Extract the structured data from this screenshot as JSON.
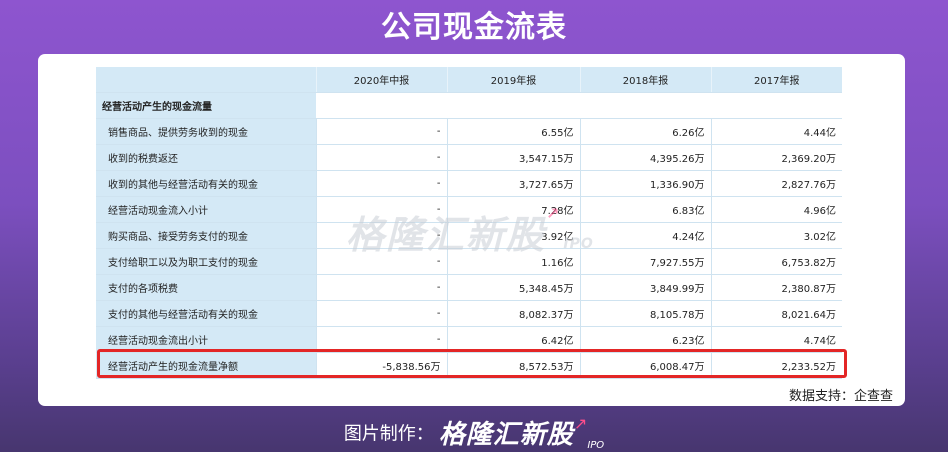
{
  "title": "公司现金流表",
  "table": {
    "headers": [
      "",
      "2020年中报",
      "2019年报",
      "2018年报",
      "2017年报"
    ],
    "section": "经营活动产生的现金流量",
    "rows": [
      {
        "label": "销售商品、提供劳务收到的现金",
        "values": [
          "-",
          "6.55亿",
          "6.26亿",
          "4.44亿"
        ]
      },
      {
        "label": "收到的税费返还",
        "values": [
          "-",
          "3,547.15万",
          "4,395.26万",
          "2,369.20万"
        ]
      },
      {
        "label": "收到的其他与经营活动有关的现金",
        "values": [
          "-",
          "3,727.65万",
          "1,336.90万",
          "2,827.76万"
        ]
      },
      {
        "label": "经营活动现金流入小计",
        "values": [
          "-",
          "7.28亿",
          "6.83亿",
          "4.96亿"
        ]
      },
      {
        "label": "购买商品、接受劳务支付的现金",
        "values": [
          "-",
          "3.92亿",
          "4.24亿",
          "3.02亿"
        ]
      },
      {
        "label": "支付给职工以及为职工支付的现金",
        "values": [
          "-",
          "1.16亿",
          "7,927.55万",
          "6,753.82万"
        ]
      },
      {
        "label": "支付的各项税费",
        "values": [
          "-",
          "5,348.45万",
          "3,849.99万",
          "2,380.87万"
        ]
      },
      {
        "label": "支付的其他与经营活动有关的现金",
        "values": [
          "-",
          "8,082.37万",
          "8,105.78万",
          "8,021.64万"
        ]
      },
      {
        "label": "经营活动现金流出小计",
        "values": [
          "-",
          "6.42亿",
          "6.23亿",
          "4.74亿"
        ]
      },
      {
        "label": "经营活动产生的现金流量净额",
        "values": [
          "-5,838.56万",
          "8,572.53万",
          "6,008.47万",
          "2,233.52万"
        ]
      }
    ]
  },
  "watermark": {
    "brand": "格隆汇新股",
    "ipo": "IPO"
  },
  "source": "数据支持：企查查",
  "footer": {
    "made_by": "图片制作：",
    "brand": "格隆汇新股",
    "ipo": "IPO"
  },
  "colors": {
    "highlight": "#e32626",
    "header_bg": "#d4e9f6",
    "background": "#8e55cf"
  },
  "icons": {
    "brand_arrow": "rising-arrow-icon"
  }
}
